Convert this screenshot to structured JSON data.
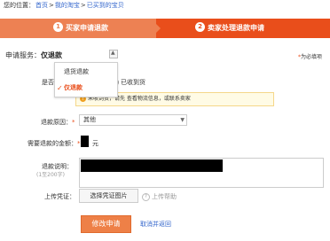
{
  "breadcrumb": {
    "prefix": "您的位置：",
    "items": [
      "首页",
      "我的淘宝",
      "已买到的宝贝"
    ],
    "separator": ">"
  },
  "steps": [
    {
      "num": "1",
      "label": "买家申请退款"
    },
    {
      "num": "2",
      "label": "卖家处理退款申请"
    }
  ],
  "form": {
    "service_label": "申请服务：",
    "service_value": "仅退款",
    "required_star": "*",
    "required_text": "为必填项",
    "dropdown_options": [
      {
        "label": "退货退款",
        "selected": false
      },
      {
        "label": "仅退款",
        "selected": true
      }
    ],
    "received_label": "是否收到货：",
    "received_option": "已收到货",
    "tip_text": "未收到货，请先 查看物流信息，或联系卖家",
    "reason_label": "退款原因：",
    "reason_value": "其他",
    "amount_label": "需要退款的金额：",
    "amount_unit": "元",
    "desc_label": "退款说明：",
    "desc_sub": "(1至200字)",
    "upload_label": "上传凭证：",
    "upload_button": "选择凭证图片",
    "upload_help": "上传帮助",
    "submit_button": "修改申请",
    "cancel_link": "取消并返回"
  },
  "colors": {
    "step1": "#ed8153",
    "step2": "#e94e1b",
    "link": "#3366cc",
    "submit": "#ee8047"
  }
}
